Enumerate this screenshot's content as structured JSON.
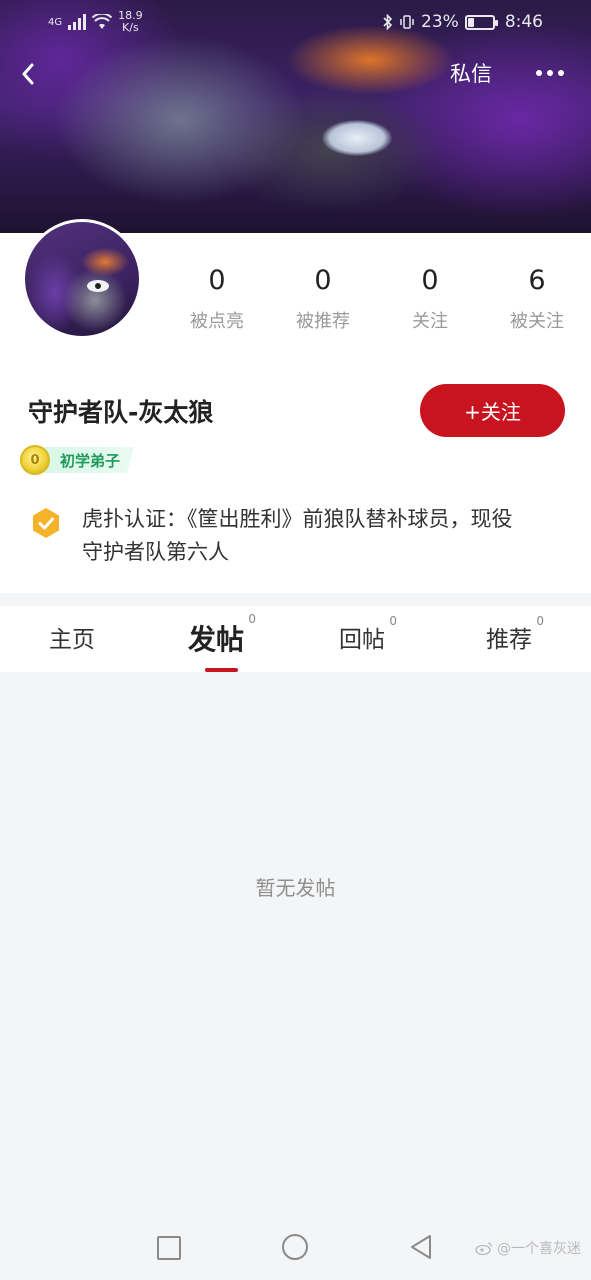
{
  "status_bar": {
    "network": "4G",
    "speed_value": "18.9",
    "speed_unit": "K/s",
    "battery_percent": "23%",
    "battery_level": 0.23,
    "time": "8:46"
  },
  "top_nav": {
    "message_label": "私信"
  },
  "profile": {
    "stats": [
      {
        "value": "0",
        "label": "被点亮"
      },
      {
        "value": "0",
        "label": "被推荐"
      },
      {
        "value": "0",
        "label": "关注"
      },
      {
        "value": "6",
        "label": "被关注"
      }
    ],
    "username": "守护者队-灰太狼",
    "follow_label": "+关注",
    "level_coin": "0",
    "level_label": "初学弟子",
    "verify_text": "虎扑认证：《筐出胜利》前狼队替补球员，现役守护者队第六人"
  },
  "tabs": [
    {
      "label": "主页",
      "count": ""
    },
    {
      "label": "发帖",
      "count": "0",
      "active": true
    },
    {
      "label": "回帖",
      "count": "0"
    },
    {
      "label": "推荐",
      "count": "0"
    }
  ],
  "content": {
    "empty_text": "暂无发帖"
  },
  "watermark": "@一个喜灰迷",
  "colors": {
    "accent": "#c8141e",
    "level_green": "#1f9a5a",
    "verify_gold": "#f4b32a"
  }
}
